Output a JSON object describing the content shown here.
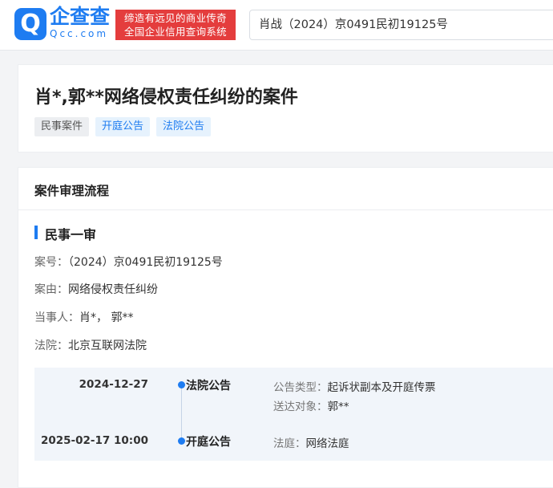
{
  "header": {
    "logo_mark": "Q",
    "logo_cn": "企查查",
    "logo_en": "Qcc.com",
    "slogan_line1": "缔造有远见的商业传奇",
    "slogan_line2": "全国企业信用查询系统",
    "search_value": "肖战（2024）京0491民初19125号"
  },
  "case": {
    "title": "肖*,郭**网络侵权责任纠纷的案件",
    "tags": [
      "民事案件",
      "开庭公告",
      "法院公告"
    ]
  },
  "process": {
    "section_title": "案件审理流程",
    "stage_title": "民事一审",
    "case_no_label": "案号：",
    "case_no": "（2024）京0491民初19125号",
    "cause_label": "案由：",
    "cause": "网络侵权责任纠纷",
    "parties_label": "当事人：",
    "parties": "肖*， 郭**",
    "court_label": "法院：",
    "court": "北京互联网法院",
    "timeline": [
      {
        "date": "2024-12-27",
        "type": "法院公告",
        "detail1_label": "公告类型：",
        "detail1": "起诉状副本及开庭传票",
        "detail2_label": "送达对象：",
        "detail2": "郭**"
      },
      {
        "date": "2025-02-17 10:00",
        "type": "开庭公告",
        "detail1_label": "法庭：",
        "detail1": "网络法庭"
      }
    ]
  },
  "colors": {
    "brand_blue": "#1e7cf1",
    "slogan_red": "#e43d3d"
  }
}
